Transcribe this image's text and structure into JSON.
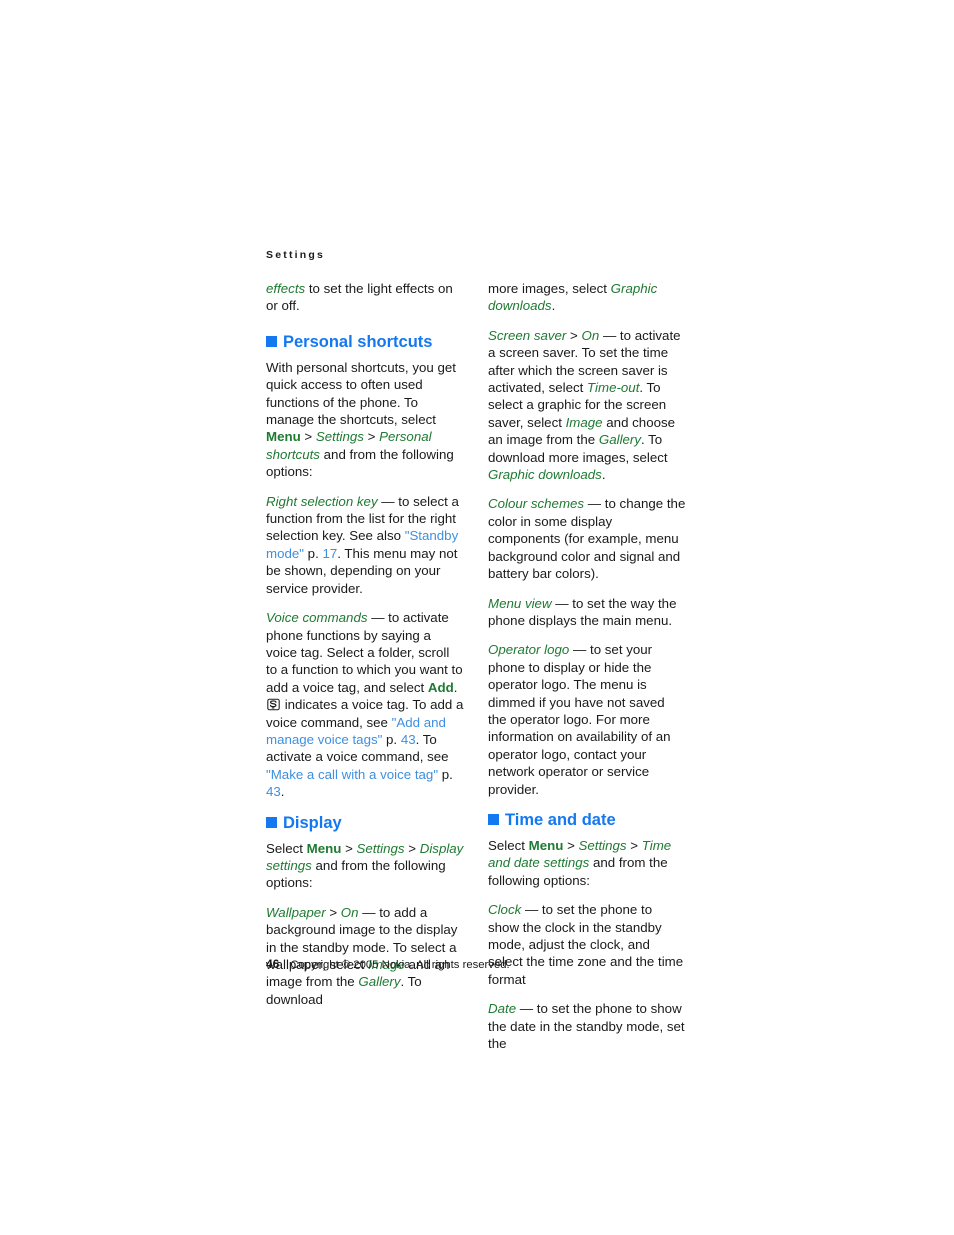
{
  "page": {
    "running_head": "Settings",
    "page_number": "46",
    "copyright": "Copyright © 2005 Nokia. All rights reserved."
  },
  "colors": {
    "heading_blue": "#1478f0",
    "menu_green": "#1f7a32",
    "link_blue": "#3f8fe0",
    "body_text": "#1a1a1a",
    "background": "#ffffff"
  },
  "left_column": {
    "continued_paragraph": {
      "menu_term": "effects",
      "text": " to set the light effects on or off."
    },
    "personal_shortcuts": {
      "heading": "Personal shortcuts",
      "bullet_icon": "square-bullet-icon",
      "intro_1": "With personal shortcuts, you get quick access to often used functions of the phone. To manage the shortcuts, select ",
      "intro_menu": "Menu",
      "intro_sep1": " > ",
      "intro_settings": "Settings",
      "intro_sep2": " > ",
      "intro_personal": "Personal shortcuts",
      "intro_2": " and from the following options:",
      "right_selection_key": {
        "term": "Right selection key",
        "text_1": " — to select a function from the list for the right selection key. See also ",
        "link": "\"Standby mode\"",
        "text_2": " p. ",
        "page_ref": "17",
        "text_3": ". This menu may not be shown, depending on your service provider."
      },
      "voice_commands": {
        "term": "Voice commands",
        "text_1": " — to activate phone functions by saying a voice tag. Select a folder, scroll to a function to which you want to add a voice tag, and select ",
        "add_label": "Add",
        "text_2": ". ",
        "icon": "voice-tag-icon",
        "text_3": " indicates a voice tag. To add a voice command, see ",
        "link_1": "\"Add and manage voice tags\"",
        "text_4": " p. ",
        "page_ref_1": "43",
        "text_5": ". To activate a voice command, see ",
        "link_2": "\"Make a call with a voice tag\"",
        "text_6": " p. ",
        "page_ref_2": "43",
        "text_7": "."
      }
    },
    "display": {
      "heading": "Display",
      "bullet_icon": "square-bullet-icon",
      "intro_1": "Select ",
      "intro_menu": "Menu",
      "intro_sep1": " > ",
      "intro_settings": "Settings",
      "intro_sep2": " > ",
      "intro_display": "Display settings",
      "intro_2": " and from the following options:",
      "wallpaper": {
        "term": "Wallpaper",
        "sep": " > ",
        "on": "On",
        "text_1": " — to add a background image to the display in the standby mode. To select a wallpaper, select ",
        "image_term": "Image",
        "text_2": " and an image from the ",
        "gallery_term": "Gallery",
        "text_3": ". To download"
      }
    }
  },
  "right_column": {
    "wallpaper_continued": {
      "text_1": "more images, select ",
      "term": "Graphic downloads",
      "text_2": "."
    },
    "screen_saver": {
      "term": "Screen saver",
      "sep": " > ",
      "on": "On",
      "text_1": " — to activate a screen saver. To set the time after which the screen saver is activated, select ",
      "timeout_term": "Time-out",
      "text_2": ". To select a graphic for the screen saver, select ",
      "image_term": "Image",
      "text_3": " and choose an image from the ",
      "gallery_term": "Gallery",
      "text_4": ". To download more images, select ",
      "graphic_downloads_term": "Graphic downloads",
      "text_5": "."
    },
    "colour_schemes": {
      "term": "Colour schemes",
      "text": " — to change the color in some display components (for example, menu background color and signal and battery bar colors)."
    },
    "menu_view": {
      "term": "Menu view",
      "text": " — to set the way the phone displays the main menu."
    },
    "operator_logo": {
      "term": "Operator logo",
      "text": " — to set your phone to display or hide the operator logo. The menu is dimmed if you have not saved the operator logo. For more information on availability of an operator logo, contact your network operator or service provider."
    },
    "time_and_date": {
      "heading": "Time and date",
      "bullet_icon": "square-bullet-icon",
      "intro_1": "Select ",
      "intro_menu": "Menu",
      "intro_sep1": " > ",
      "intro_settings": "Settings",
      "intro_sep2": " > ",
      "intro_timedate": "Time and date settings",
      "intro_2": " and from the following options:",
      "clock": {
        "term": "Clock",
        "text": " — to set the phone to show the clock in the standby mode, adjust the clock, and select the time zone and the time format"
      },
      "date": {
        "term": "Date",
        "text": " — to set the phone to show the date in the standby mode, set the"
      }
    }
  }
}
